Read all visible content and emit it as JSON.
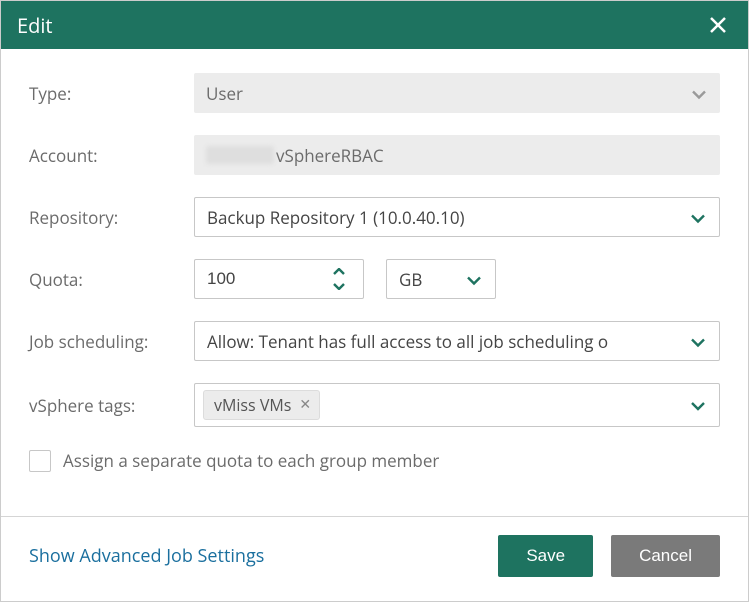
{
  "titlebar": {
    "title": "Edit"
  },
  "form": {
    "type": {
      "label": "Type:",
      "value": "User"
    },
    "account": {
      "label": "Account:",
      "value": "vSphereRBAC"
    },
    "repository": {
      "label": "Repository:",
      "value": "Backup Repository 1 (10.0.40.10)"
    },
    "quota": {
      "label": "Quota:",
      "value": "100",
      "unit": "GB"
    },
    "scheduling": {
      "label": "Job scheduling:",
      "value": "Allow: Tenant has full access to all job scheduling o"
    },
    "tags": {
      "label": "vSphere tags:",
      "tag0": "vMiss VMs"
    },
    "separate_quota_label": "Assign a separate quota to each group member"
  },
  "footer": {
    "advanced_link": "Show Advanced Job Settings",
    "save": "Save",
    "cancel": "Cancel"
  }
}
